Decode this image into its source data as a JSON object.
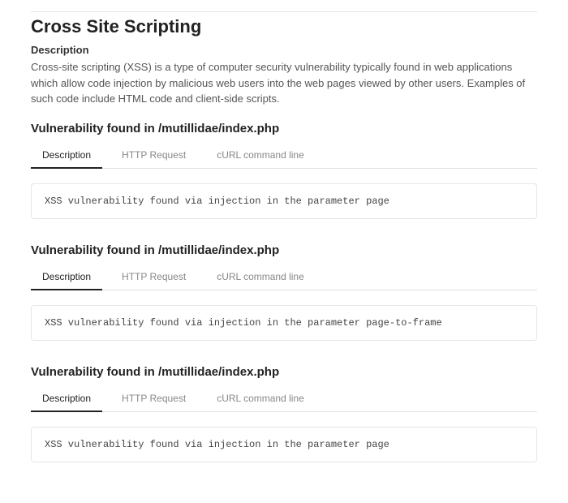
{
  "title": "Cross Site Scripting",
  "description_label": "Description",
  "description_text": "Cross-site scripting (XSS) is a type of computer security vulnerability typically found in web applications which allow code injection by malicious web users into the web pages viewed by other users. Examples of such code include HTML code and client-side scripts.",
  "tabs": {
    "description": "Description",
    "http_request": "HTTP Request",
    "curl": "cURL command line"
  },
  "findings": [
    {
      "heading": "Vulnerability found in /mutillidae/index.php",
      "content": "XSS vulnerability found via injection in the parameter page"
    },
    {
      "heading": "Vulnerability found in /mutillidae/index.php",
      "content": "XSS vulnerability found via injection in the parameter page-to-frame"
    },
    {
      "heading": "Vulnerability found in /mutillidae/index.php",
      "content": "XSS vulnerability found via injection in the parameter page"
    }
  ]
}
